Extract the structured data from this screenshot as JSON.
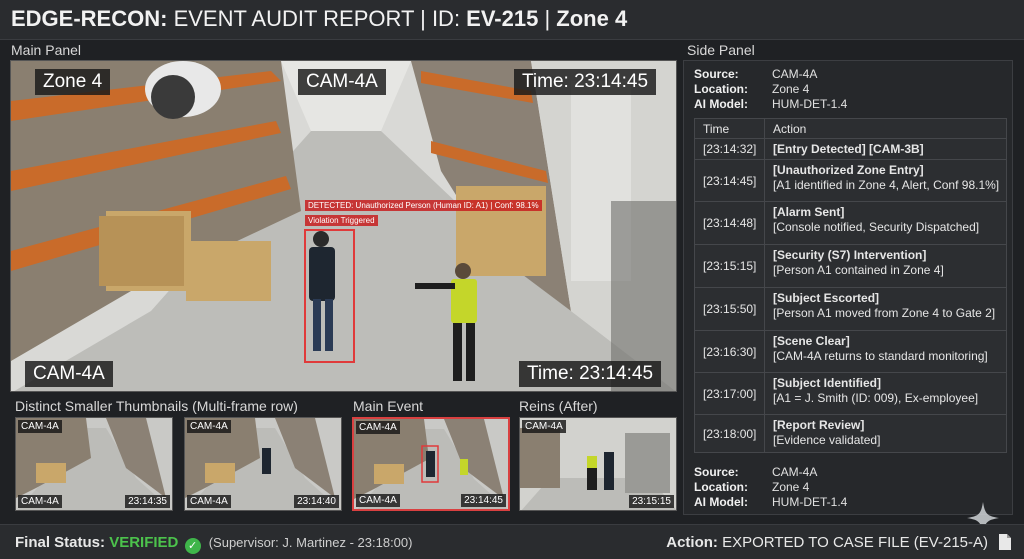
{
  "header": {
    "app": "EDGE-RECON:",
    "report": " EVENT AUDIT REPORT | ID: ",
    "id": "EV-215",
    "sep": " | ",
    "zone": "Zone 4"
  },
  "main_panel": {
    "label": "Main Panel",
    "zone": "Zone 4",
    "cam_top": "CAM-4A",
    "time_top": "Time: 23:14:45",
    "cam_bottom": "CAM-4A",
    "time_bottom": "Time: 23:14:45",
    "detection": "DETECTED: Unauthorized Person (Human ID: A1) | Conf: 98.1%",
    "violation": "Violation Triggered"
  },
  "thumbnails": {
    "section_label": "Distinct Smaller Thumbnails (Multi-frame row)",
    "main_label": "Main Event",
    "after_label": "Reins (After)",
    "items": [
      {
        "cam_top": "CAM-4A",
        "cam_bottom": "CAM-4A",
        "time": "23:14:35"
      },
      {
        "cam_top": "CAM-4A",
        "cam_bottom": "CAM-4A",
        "time": "23:14:40"
      },
      {
        "cam_top": "CAM-4A",
        "cam_bottom": "CAM-4A",
        "time": "23:14:45"
      },
      {
        "cam_top": "CAM-4A",
        "cam_bottom": "",
        "time": "23:15:15"
      }
    ]
  },
  "side_panel": {
    "label": "Side Panel",
    "meta_top": [
      {
        "key": "Source:",
        "value": "CAM-4A"
      },
      {
        "key": "Location:",
        "value": "Zone 4"
      },
      {
        "key": "AI Model:",
        "value": "HUM-DET-1.4"
      }
    ],
    "table_headers": {
      "time": "Time",
      "action": "Action"
    },
    "events": [
      {
        "time": "[23:14:32]",
        "event": "[Entry Detected] [CAM-3B]",
        "detail": ""
      },
      {
        "time": "[23:14:45]",
        "event": "[Unauthorized Zone Entry]",
        "detail": "[A1 identified in Zone 4, Alert, Conf 98.1%]"
      },
      {
        "time": "[23:14:48]",
        "event": "[Alarm Sent]",
        "detail": "[Console notified, Security Dispatched]"
      },
      {
        "time": "[23:15:15]",
        "event": "[Security (S7) Intervention]",
        "detail": "[Person A1 contained in Zone 4]"
      },
      {
        "time": "[23:15:50]",
        "event": "[Subject Escorted]",
        "detail": "[Person A1 moved from Zone 4 to Gate 2]"
      },
      {
        "time": "[23:16:30]",
        "event": "[Scene Clear]",
        "detail": "[CAM-4A returns to standard monitoring]"
      },
      {
        "time": "[23:17:00]",
        "event": "[Subject Identified]",
        "detail": "[A1 = J. Smith (ID: 009), Ex-employee]"
      },
      {
        "time": "[23:18:00]",
        "event": "[Report Review]",
        "detail": "[Evidence validated]"
      }
    ],
    "meta_bottom": [
      {
        "key": "Source:",
        "value": "CAM-4A"
      },
      {
        "key": "Location:",
        "value": "Zone 4"
      },
      {
        "key": "AI Model:",
        "value": "HUM-DET-1.4"
      }
    ]
  },
  "footer": {
    "status_label": "Final Status:",
    "status_value": "VERIFIED",
    "supervisor": "(Supervisor: J. Martinez - 23:18:00)",
    "action_label": "Action:",
    "action_value": "EXPORTED TO CASE FILE (EV-215-A)"
  },
  "colors": {
    "verified": "#4cc24c",
    "alert": "#e03a3a",
    "background": "#1f2124"
  },
  "icons": [
    "check-circle-icon",
    "document-icon",
    "sparkle-icon"
  ]
}
